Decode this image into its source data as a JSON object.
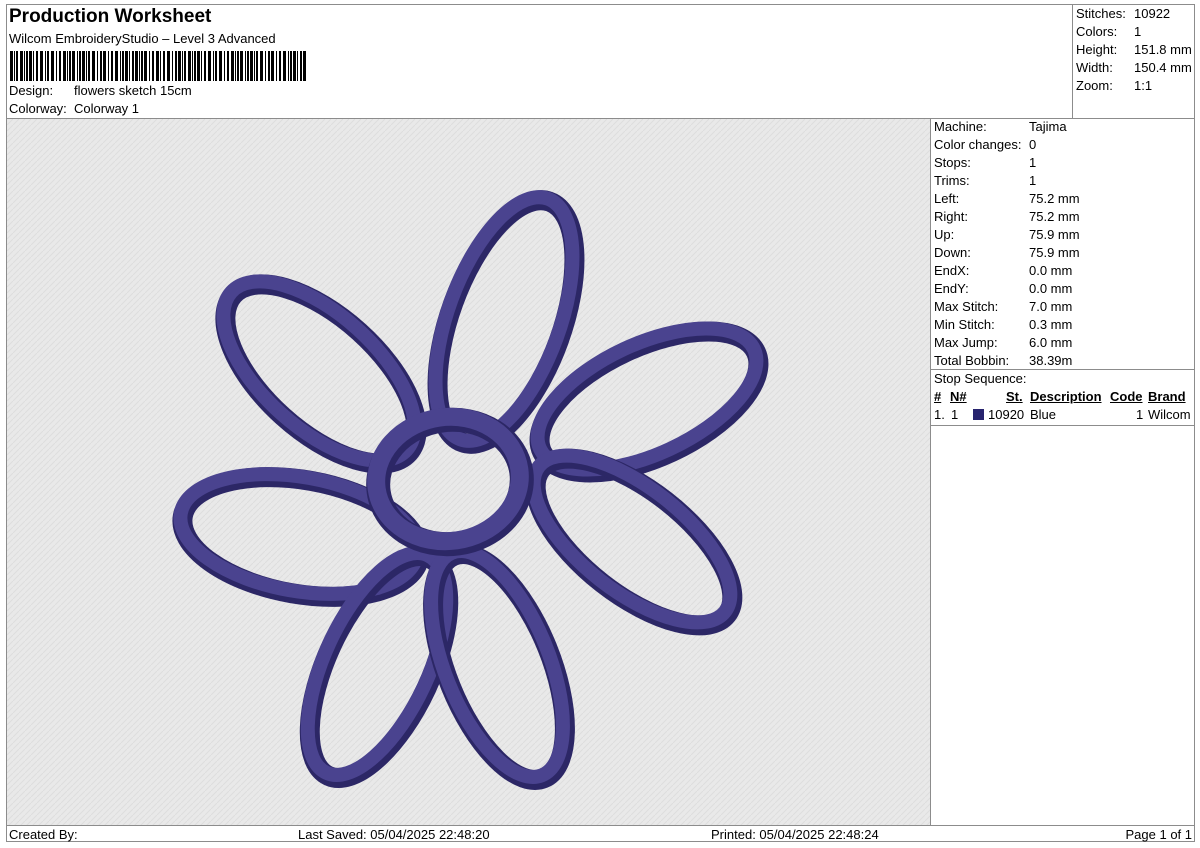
{
  "header": {
    "title": "Production Worksheet",
    "subtitle": "Wilcom EmbroideryStudio – Level 3 Advanced",
    "design_label": "Design:",
    "design_value": "flowers sketch 15cm",
    "colorway_label": "Colorway:",
    "colorway_value": "Colorway 1"
  },
  "header_stats": [
    {
      "label": "Stitches:",
      "value": "10922"
    },
    {
      "label": "Colors:",
      "value": "1"
    },
    {
      "label": "Height:",
      "value": "151.8 mm"
    },
    {
      "label": "Width:",
      "value": "150.4 mm"
    },
    {
      "label": "Zoom:",
      "value": "1:1"
    }
  ],
  "machine_stats": [
    {
      "label": "Machine:",
      "value": "Tajima"
    },
    {
      "label": "Color changes:",
      "value": "0"
    },
    {
      "label": "Stops:",
      "value": "1"
    },
    {
      "label": "Trims:",
      "value": "1"
    },
    {
      "label": "Left:",
      "value": "75.2 mm"
    },
    {
      "label": "Right:",
      "value": "75.2 mm"
    },
    {
      "label": "Up:",
      "value": "75.9 mm"
    },
    {
      "label": "Down:",
      "value": "75.9 mm"
    },
    {
      "label": "EndX:",
      "value": "0.0 mm"
    },
    {
      "label": "EndY:",
      "value": "0.0 mm"
    },
    {
      "label": "Max Stitch:",
      "value": "7.0 mm"
    },
    {
      "label": "Min Stitch:",
      "value": "0.3 mm"
    },
    {
      "label": "Max Jump:",
      "value": "6.0 mm"
    },
    {
      "label": "Total Bobbin:",
      "value": "38.39m"
    }
  ],
  "stop_sequence": {
    "title": "Stop Sequence:",
    "columns": [
      "#",
      "N#",
      "St.",
      "Description",
      "Code",
      "Brand"
    ],
    "rows": [
      {
        "index": "1.",
        "n": "1",
        "stitches": "10920",
        "description": "Blue",
        "code": "1",
        "brand": "Wilcom",
        "color": "#27236e"
      }
    ]
  },
  "thread_color": "#4a438f",
  "footer": {
    "created_by": "Created By:",
    "last_saved": "Last Saved: 05/04/2025 22:48:20",
    "printed": "Printed: 05/04/2025 22:48:24",
    "page": "Page 1 of 1"
  }
}
